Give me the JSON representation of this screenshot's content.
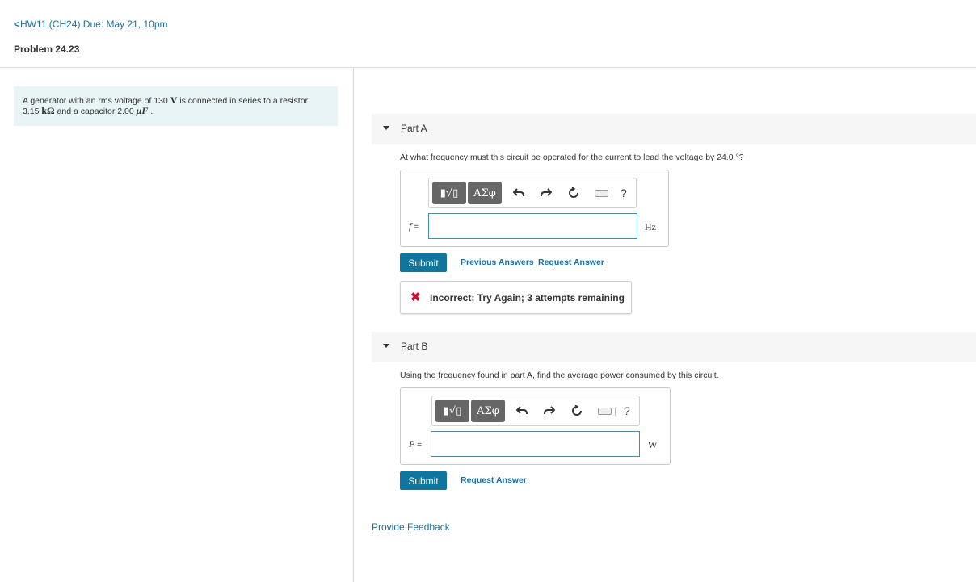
{
  "header": {
    "back_chevron": "<",
    "back_label": "HW11 (CH24) Due: May 21, 10pm",
    "problem_title": "Problem 24.23"
  },
  "problem": {
    "text_1": "A generator with an rms voltage of 130 ",
    "unit_v": "V",
    "text_2": " is connected in series to a resistor",
    "text_3": "3.15 ",
    "unit_kohm": "kΩ",
    "text_4": " and a capacitor 2.00 ",
    "unit_uf": "μF",
    "text_5": " ."
  },
  "toolbar": {
    "template_button": "▮√▯",
    "symbols_button": "ΑΣφ",
    "undo_icon": "undo-icon",
    "redo_icon": "redo-icon",
    "reset_icon": "reset-icon",
    "keyboard_icon": "keyboard-icon",
    "help_label": "?"
  },
  "part_a": {
    "label": "Part A",
    "question": "At what frequency must this circuit be operated for the current to lead the voltage by 24.0 °?",
    "variable": "f",
    "equals": " =",
    "input_value": "",
    "unit": "Hz",
    "submit_label": "Submit",
    "previous_answers_label": "Previous Answers",
    "request_answer_label": "Request Answer",
    "feedback": {
      "icon": "✖",
      "message": "Incorrect; Try Again; 3 attempts remaining",
      "color": "#c8102e"
    }
  },
  "part_b": {
    "label": "Part B",
    "question": "Using the frequency found in part A, find the average power consumed by this circuit.",
    "variable": "P",
    "equals": " =",
    "input_value": "",
    "unit": "W",
    "submit_label": "Submit",
    "request_answer_label": "Request Answer"
  },
  "provide_feedback_label": "Provide Feedback",
  "colors": {
    "accent": "#0f76a0",
    "link": "#1f6f99",
    "problem_bg": "#e8f4f6"
  }
}
